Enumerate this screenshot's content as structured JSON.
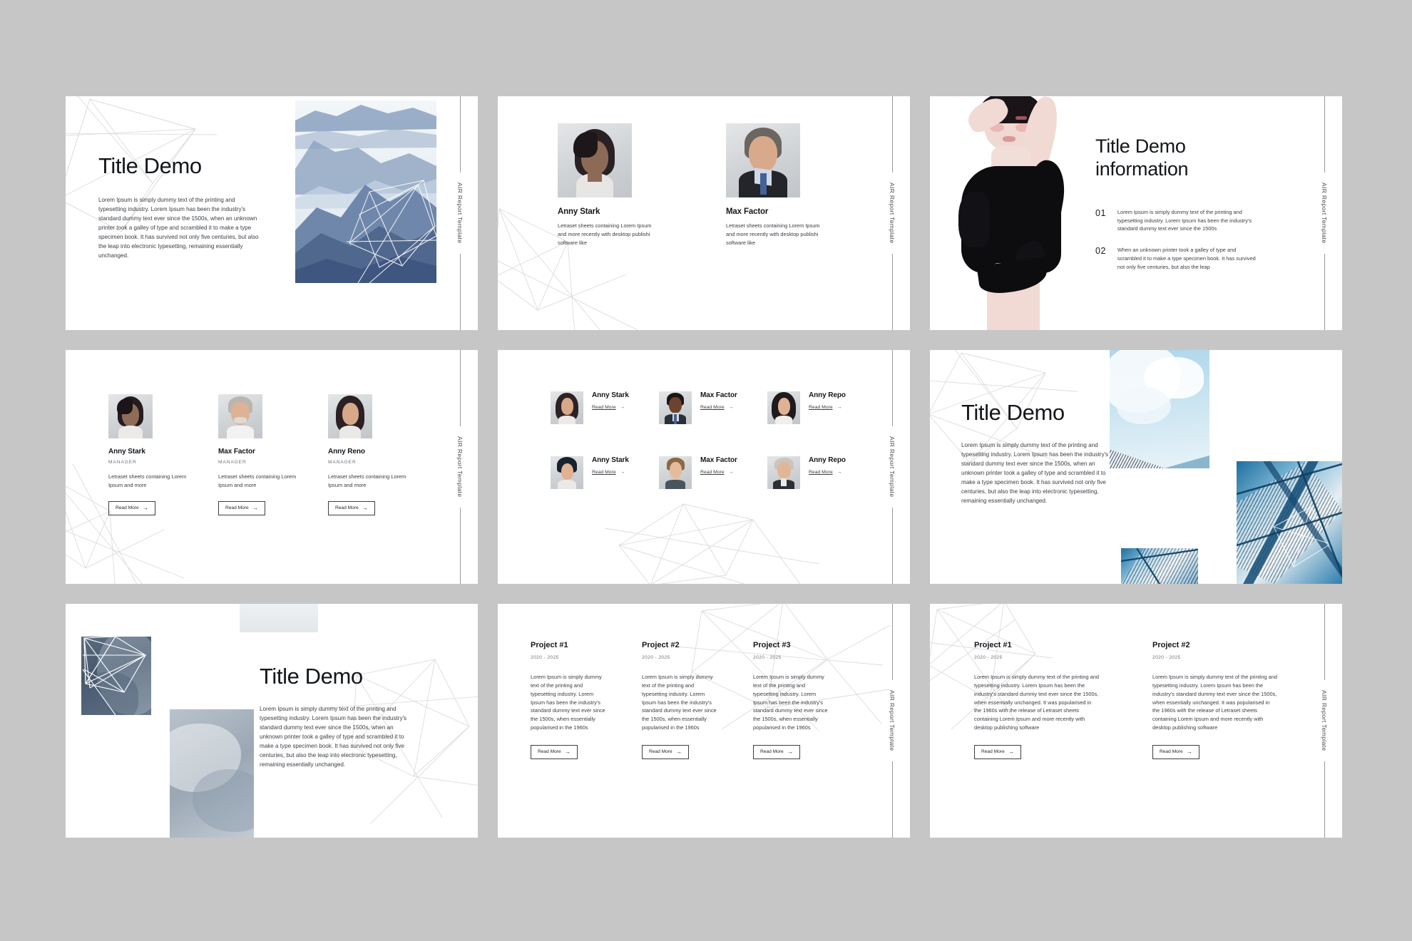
{
  "brand": {
    "vertical_label": "AIR Report Template"
  },
  "common": {
    "read_more": "Read More",
    "arrow": "→",
    "role_manager": "MANAGER",
    "project_date": "2020 - 2025"
  },
  "slides": [
    {
      "id": "slide-title-demo-mountains",
      "title": "Title Demo",
      "body": "Lorem Ipsum is simply dummy text of the printing and typesetting industry. Lorem Ipsum has been the industry's standard dummy text ever since the 1500s, when an unknown printer took a galley of type and scrambled it to make a type specimen book. It has survived not only five centuries, but also the leap into electronic typesetting, remaining essentially unchanged."
    },
    {
      "id": "slide-two-people",
      "people": [
        {
          "name": "Anny Stark",
          "desc": "Letraset sheets containing Lorem Ipsum and more recently with desktop publishi software like"
        },
        {
          "name": "Max Factor",
          "desc": "Letraset sheets containing Lorem Ipsum and more recently with desktop publishi software like"
        }
      ]
    },
    {
      "id": "slide-title-demo-information",
      "title_line1": "Title Demo",
      "title_line2": "information",
      "items": [
        {
          "num": "01",
          "text": "Lorem Ipsum is simply dummy text of the printing and typesetting industry. Lorem Ipsum has been the industry's standard dummy text ever since the 1500s"
        },
        {
          "num": "02",
          "text": "When an unknown printer took a galley of type and scrambled it to make a type specimen book. It has survived not only five centuries, but also the leap"
        }
      ]
    },
    {
      "id": "slide-three-managers",
      "people": [
        {
          "name": "Anny Stark",
          "role": "MANAGER",
          "desc": "Letraset sheets containing Lorem Ipsum and more"
        },
        {
          "name": "Max Factor",
          "role": "MANAGER",
          "desc": "Letraset sheets containing Lorem Ipsum and more"
        },
        {
          "name": "Anny Reno",
          "role": "MANAGER",
          "desc": "Letraset sheets containing Lorem Ipsum and more"
        }
      ]
    },
    {
      "id": "slide-six-people-grid",
      "people": [
        {
          "name": "Anny Stark",
          "link": "Read More"
        },
        {
          "name": "Max Factor",
          "link": "Read More"
        },
        {
          "name": "Anny Repo",
          "link": "Read More"
        },
        {
          "name": "Anny Stark",
          "link": "Read More"
        },
        {
          "name": "Max Factor",
          "link": "Read More"
        },
        {
          "name": "Anny Repo",
          "link": "Read More"
        }
      ]
    },
    {
      "id": "slide-title-demo-glass",
      "title": "Title Demo",
      "body": "Lorem Ipsum is simply dummy text of the printing and typesetting industry. Lorem Ipsum has been the industry's standard dummy text ever since the 1500s, when an unknown printer took a galley of type and scrambled it to make a type specimen book. It has survived not only five centuries, but also the leap into electronic typesetting, remaining essentially unchanged."
    },
    {
      "id": "slide-title-demo-moody",
      "title": "Title Demo",
      "body": "Lorem Ipsum is simply dummy text of the printing and typesetting industry. Lorem Ipsum has been the industry's standard dummy text ever since the 1500s, when an unknown printer took a galley of type and scrambled it to make a type specimen book. It has survived not only five centuries, but also the leap into electronic typesetting, remaining essentially unchanged."
    },
    {
      "id": "slide-three-projects",
      "projects": [
        {
          "title": "Project #1",
          "date": "2020 - 2025",
          "body": "Lorem Ipsum is simply dummy text of the printing and typesetting industry. Lorem Ipsum has been the industry's standard dummy text ever since the 1500s, when essentially popularised in the 1960s",
          "cta": "Read More"
        },
        {
          "title": "Project #2",
          "date": "2020 - 2025",
          "body": "Lorem Ipsum is simply dummy text of the printing and typesetting industry. Lorem Ipsum has been the industry's standard dummy text ever since the 1500s, when essentially popularised in the 1960s",
          "cta": "Read More"
        },
        {
          "title": "Project #3",
          "date": "2020 - 2025",
          "body": "Lorem Ipsum is simply dummy text of the printing and typesetting industry. Lorem Ipsum has been the industry's standard dummy text ever since the 1500s, when essentially popularised in the 1960s",
          "cta": "Read More"
        }
      ]
    },
    {
      "id": "slide-two-projects",
      "projects": [
        {
          "title": "Project #1",
          "date": "2020 - 2025",
          "body": "Lorem Ipsum is simply dummy text of the printing and typesetting industry. Lorem Ipsum has been the industry's standard dummy text ever since the 1500s, when essentially unchanged. It was popularised in the 1960s with the release of Letraset sheets containing Lorem Ipsum and more recently with desktop publishing software",
          "cta": "Read More"
        },
        {
          "title": "Project #2",
          "date": "2020 - 2025",
          "body": "Lorem Ipsum is simply dummy text of the printing and typesetting industry. Lorem Ipsum has been the industry's standard dummy text ever since the 1500s, when essentially unchanged. It was popularised in the 1960s with the release of Letraset sheets containing Lorem Ipsum and more recently with desktop publishing software",
          "cta": "Read More"
        }
      ]
    }
  ]
}
